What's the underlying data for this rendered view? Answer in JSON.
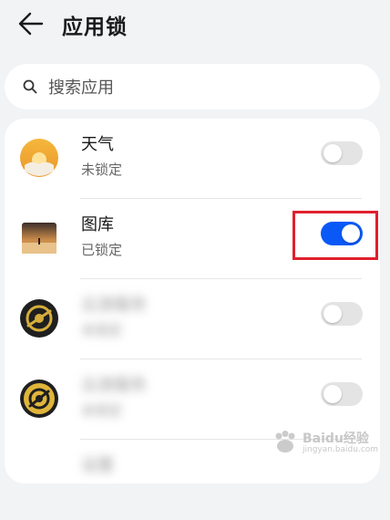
{
  "header": {
    "title": "应用锁"
  },
  "search": {
    "placeholder": "搜索应用"
  },
  "apps": [
    {
      "name": "天气",
      "status": "未锁定",
      "locked": false,
      "icon": "weather-icon"
    },
    {
      "name": "图库",
      "status": "已锁定",
      "locked": true,
      "icon": "gallery-icon"
    },
    {
      "name": "云游服务",
      "status": "未锁定",
      "locked": false,
      "icon": "app-icon",
      "blurred": true
    },
    {
      "name": "云游服务",
      "status": "未锁定",
      "locked": false,
      "icon": "app-icon",
      "blurred": true
    },
    {
      "name": "设置",
      "status": "",
      "locked": false,
      "icon": "app-icon",
      "blurred": true
    }
  ],
  "watermark": {
    "text": "Baidu经验",
    "sub": "jingyan.baidu.com"
  },
  "colors": {
    "accent": "#0a59f7",
    "highlight": "#e0202c",
    "background": "#f1f3f5"
  }
}
